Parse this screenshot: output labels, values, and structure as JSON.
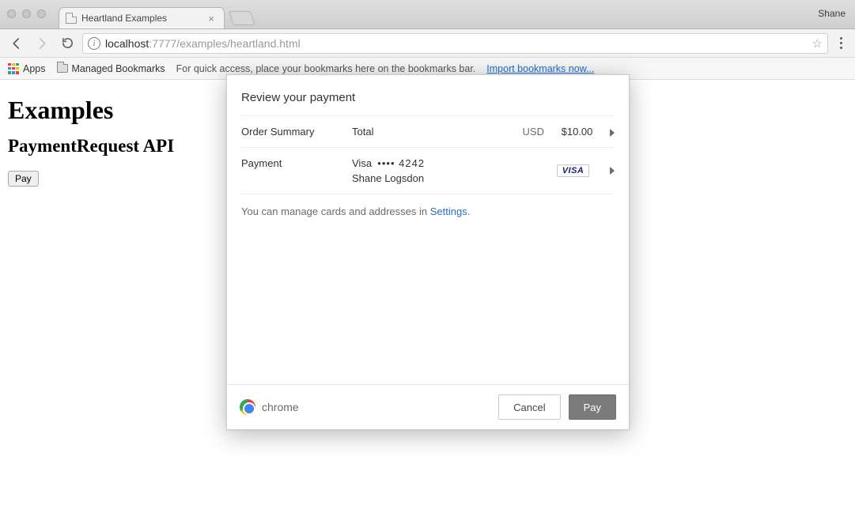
{
  "browser": {
    "profile": "Shane",
    "tab_title": "Heartland Examples",
    "url_host": "localhost",
    "url_port_path": ":7777/examples/heartland.html",
    "apps_label": "Apps",
    "managed_bookmarks": "Managed Bookmarks",
    "bookmarks_hint": "For quick access, place your bookmarks here on the bookmarks bar.",
    "import_link": "Import bookmarks now..."
  },
  "page": {
    "h1": "Examples",
    "h2": "PaymentRequest API",
    "pay_button": "Pay"
  },
  "sheet": {
    "title": "Review your payment",
    "order": {
      "label": "Order Summary",
      "total_label": "Total",
      "currency": "USD",
      "amount": "$10.00"
    },
    "payment": {
      "label": "Payment",
      "card_brand": "Visa",
      "card_mask": "•••• 4242",
      "name": "Shane Logsdon",
      "badge": "VISA"
    },
    "manage_prefix": "You can manage cards and addresses in ",
    "manage_link": "Settings",
    "brand": "chrome",
    "cancel": "Cancel",
    "pay": "Pay"
  }
}
